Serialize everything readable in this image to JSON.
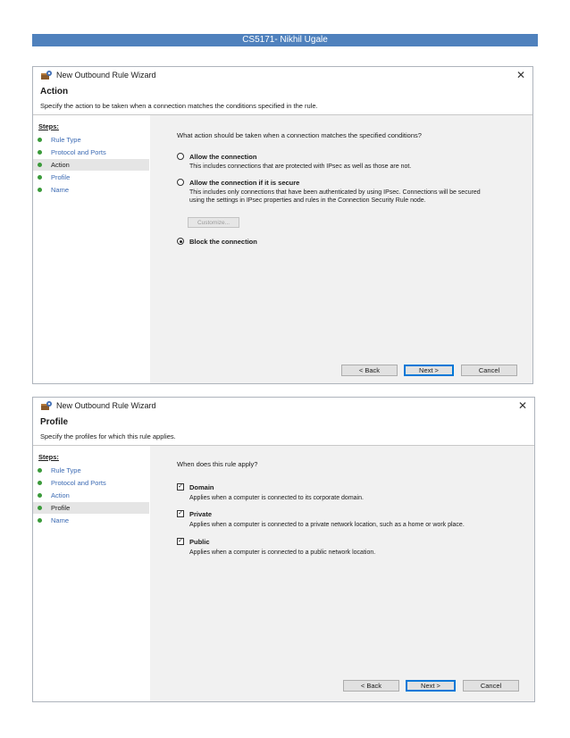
{
  "header": {
    "text": "CS5171- Nikhil Ugale"
  },
  "wizard1": {
    "title": "New Outbound Rule Wizard",
    "close": "✕",
    "heading": "Action",
    "subtitle": "Specify the action to be taken when a connection matches the conditions specified in the rule.",
    "steps_title": "Steps:",
    "steps": [
      "Rule Type",
      "Protocol and Ports",
      "Action",
      "Profile",
      "Name"
    ],
    "active_step": "Action",
    "question": "What action should be taken when a connection matches the specified conditions?",
    "options": [
      {
        "label": "Allow the connection",
        "desc": "This includes connections that are protected with IPsec as well as those are not.",
        "selected": false
      },
      {
        "label": "Allow the connection if it is secure",
        "desc": "This includes only connections that have been authenticated by using IPsec. Connections will be secured using the settings in IPsec properties and rules in the Connection Security Rule node.",
        "selected": false
      },
      {
        "label": "Block the connection",
        "desc": "",
        "selected": true
      }
    ],
    "customize_label": "Customize...",
    "buttons": {
      "back": "< Back",
      "next": "Next >",
      "cancel": "Cancel"
    }
  },
  "wizard2": {
    "title": "New Outbound Rule Wizard",
    "close": "✕",
    "heading": "Profile",
    "subtitle": "Specify the profiles for which this rule applies.",
    "steps_title": "Steps:",
    "steps": [
      "Rule Type",
      "Protocol and Ports",
      "Action",
      "Profile",
      "Name"
    ],
    "active_step": "Profile",
    "question": "When does this rule apply?",
    "options": [
      {
        "label": "Domain",
        "desc": "Applies when a computer is connected to its corporate domain.",
        "checked": true
      },
      {
        "label": "Private",
        "desc": "Applies when a computer is connected to a private network location, such as a home or work place.",
        "checked": true
      },
      {
        "label": "Public",
        "desc": "Applies when a computer is connected to a public network location.",
        "checked": true
      }
    ],
    "buttons": {
      "back": "< Back",
      "next": "Next >",
      "cancel": "Cancel"
    }
  },
  "icons": {
    "app": "firewall-wizard-icon",
    "step": "green-step-dot-icon",
    "close": "close-icon"
  },
  "colors": {
    "banner": "#4f81bd",
    "link": "#3b6ab3",
    "step_dot": "#3a9a3a",
    "content_bg": "#f1f1f1",
    "default_button_border": "#0078d7"
  }
}
